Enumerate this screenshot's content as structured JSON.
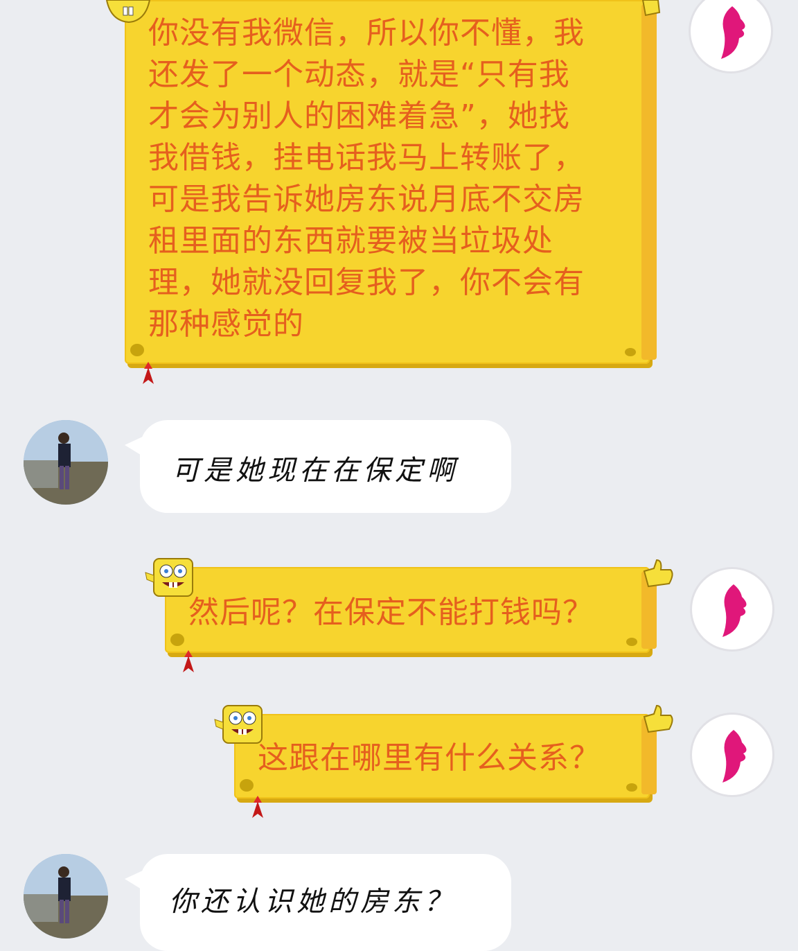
{
  "messages": [
    {
      "sender": "her",
      "text": "你没有我微信，所以你不懂，我\n还发了一个动态，就是“只有我\n才会为别人的困难着急”，她找\n我借钱，挂电话我马上转账了，\n可是我告诉她房东说月底不交房\n租里面的东西就要被当垃圾处\n理，她就没回复我了，你不会有\n那种感觉的"
    },
    {
      "sender": "him",
      "text": "可是她现在在保定啊"
    },
    {
      "sender": "her",
      "text": "然后呢？在保定不能打钱吗？"
    },
    {
      "sender": "her",
      "text": "这跟在哪里有什么关系？"
    },
    {
      "sender": "him",
      "text": "你还认识她的房东？"
    }
  ],
  "colors": {
    "background": "#ebedf1",
    "her_bubble": "#f7d42e",
    "her_text": "#e55f1e",
    "him_bubble": "#ffffff",
    "him_text": "#111111",
    "her_avatar_accent": "#e0177a"
  }
}
